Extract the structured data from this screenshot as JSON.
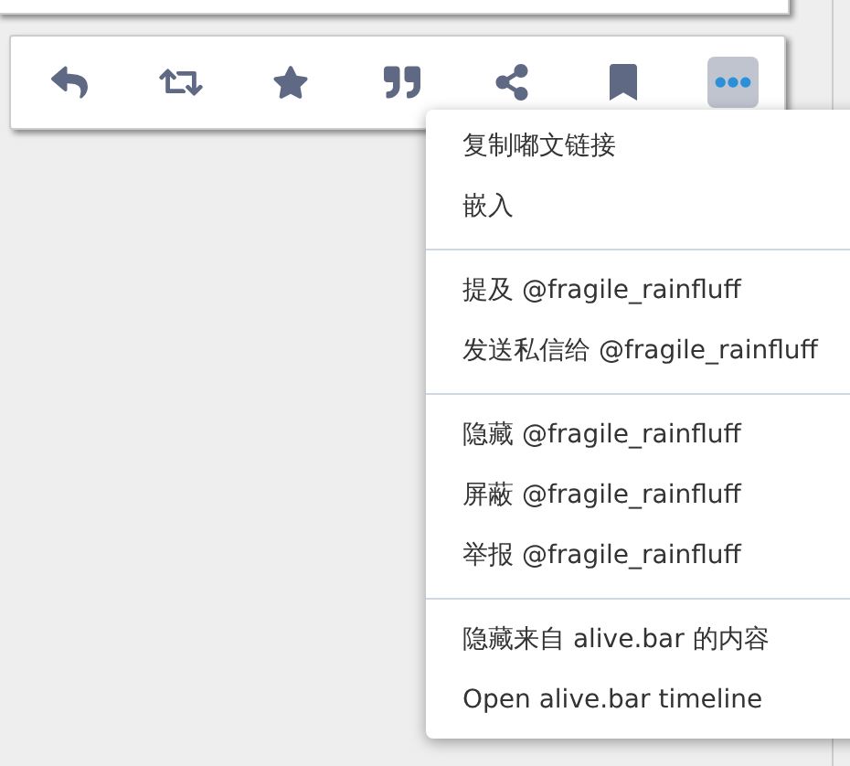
{
  "actions": [
    {
      "kind": "reply",
      "selected": false
    },
    {
      "kind": "boost",
      "selected": false
    },
    {
      "kind": "favourite",
      "selected": false
    },
    {
      "kind": "quote",
      "selected": false
    },
    {
      "kind": "share",
      "selected": false
    },
    {
      "kind": "bookmark",
      "selected": false
    },
    {
      "kind": "more",
      "selected": true
    }
  ],
  "menu": {
    "groups": [
      [
        "复制嘟文链接",
        "嵌入"
      ],
      [
        "提及 @fragile_rainfluff",
        "发送私信给 @fragile_rainfluff"
      ],
      [
        "隐藏 @fragile_rainfluff",
        "屏蔽 @fragile_rainfluff",
        "举报 @fragile_rainfluff"
      ],
      [
        "隐藏来自 alive.bar 的内容",
        "Open alive.bar timeline"
      ]
    ]
  }
}
